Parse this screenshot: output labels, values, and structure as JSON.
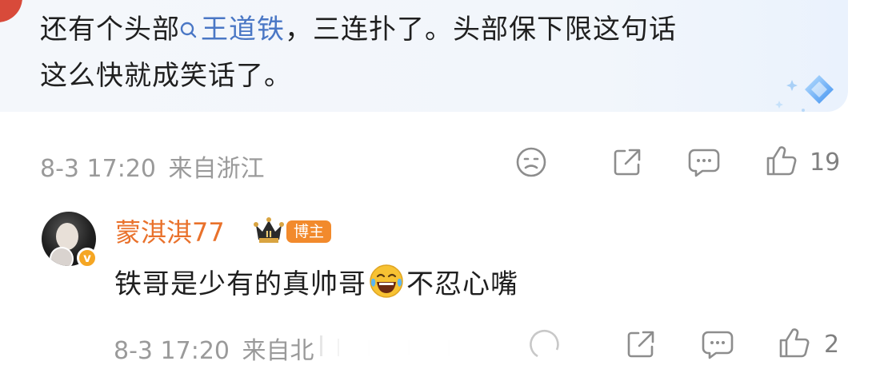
{
  "comment1": {
    "text_before": "还有个头部",
    "mention": "王道铁",
    "text_after": "，三连扑了。头部保下限这句话",
    "line2": "这么快就成笑话了。",
    "time": "8-3 17:20",
    "location": "来自浙江",
    "like_count": "19",
    "icons": [
      "sad-face-icon",
      "share-icon",
      "comment-icon",
      "thumb-up-icon"
    ]
  },
  "reply": {
    "username": "蒙淇淇77",
    "badge": "博主",
    "text_before": "铁哥是少有的真帅哥",
    "emoji": "laughing-tears-emoji",
    "text_after": "不忍心嘴",
    "time": "8-3 17:20",
    "location": "来自北",
    "like_count": "2"
  },
  "colors": {
    "mention": "#4a77c5",
    "username": "#e9712b",
    "badge_bg": "#f28a2c",
    "meta_text": "#9a9a9a"
  }
}
